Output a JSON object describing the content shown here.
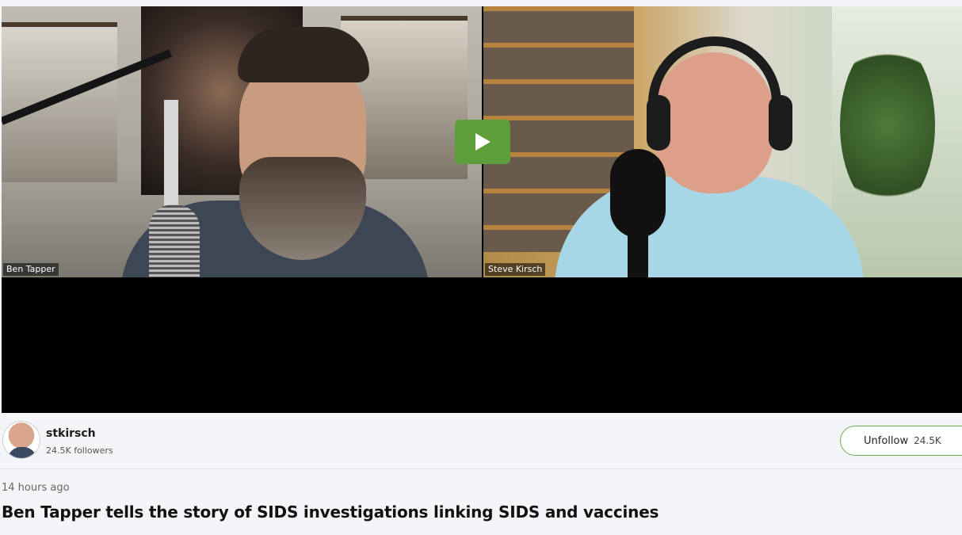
{
  "video": {
    "participants": [
      {
        "name": "Ben Tapper"
      },
      {
        "name": "Steve Kirsch"
      }
    ],
    "play_icon": "play-icon",
    "accent_color": "#5e9e3a"
  },
  "author": {
    "username": "stkirsch",
    "followers": "24.5K followers",
    "avatar_icon": "avatar"
  },
  "follow": {
    "label": "Unfollow",
    "count": "24.5K"
  },
  "post": {
    "timestamp": "14 hours ago",
    "title": "Ben Tapper tells the story of SIDS investigations linking SIDS and vaccines"
  }
}
